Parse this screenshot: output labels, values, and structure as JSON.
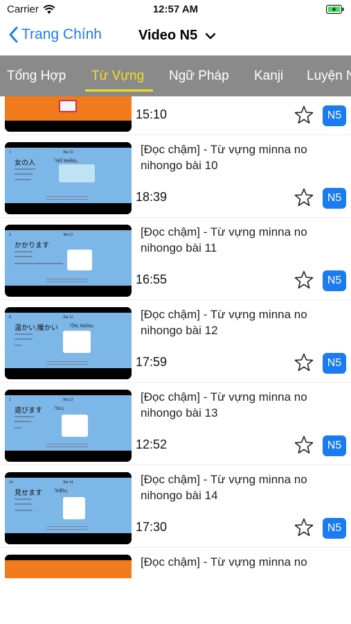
{
  "status": {
    "carrier": "Carrier",
    "time": "12:57 AM"
  },
  "nav": {
    "back_label": "Trang Chính",
    "title": "Video N5"
  },
  "tabs": [
    {
      "label": "Tổng Hợp",
      "active": false
    },
    {
      "label": "Từ Vựng",
      "active": true
    },
    {
      "label": "Ngữ Pháp",
      "active": false
    },
    {
      "label": "Kanji",
      "active": false
    },
    {
      "label": "Luyện N",
      "active": false
    }
  ],
  "colors": {
    "accent": "#1a7cf0",
    "tab_bar": "#8a8a8a",
    "tab_active": "#f3df1e"
  },
  "videos": [
    {
      "title": "",
      "duration": "15:10",
      "level": "N5",
      "slide": {
        "num": "",
        "lesson": "",
        "word": "",
        "meaning": ""
      }
    },
    {
      "title": "[Đọc chậm] - Từ vựng minna no nihongo bài 10",
      "duration": "18:39",
      "level": "N5",
      "slide": {
        "num": "1",
        "lesson": "Bài 10",
        "word": "女の人",
        "meaning": "「NỮ NHÂN」"
      }
    },
    {
      "title": "[Đọc chậm] - Từ vựng minna no nihongo bài 11",
      "duration": "16:55",
      "level": "N5",
      "slide": {
        "num": "3",
        "lesson": "Bài 11",
        "word": "かかります",
        "meaning": ""
      }
    },
    {
      "title": "[Đọc chậm] - Từ vựng minna no nihongo bài 12",
      "duration": "17:59",
      "level": "N5",
      "slide": {
        "num": "8",
        "lesson": "Bài 12",
        "word": "温かい,暖かい",
        "meaning": "「ÔN, NOÃN」"
      }
    },
    {
      "title": "[Đọc chậm] - Từ vựng minna no nihongo bài 13",
      "duration": "12:52",
      "level": "N5",
      "slide": {
        "num": "1",
        "lesson": "Bài 13",
        "word": "遊びます",
        "meaning": "「DU」"
      }
    },
    {
      "title": "[Đọc chậm] - Từ vựng minna no nihongo bài 14",
      "duration": "17:30",
      "level": "N5",
      "slide": {
        "num": "14",
        "lesson": "Bài 14",
        "word": "見せます",
        "meaning": "「KIẾN」"
      }
    },
    {
      "title": "[Đọc chậm] - Từ vựng minna no",
      "duration": "",
      "level": "",
      "slide": {
        "num": "",
        "lesson": "",
        "word": "",
        "meaning": ""
      }
    }
  ]
}
